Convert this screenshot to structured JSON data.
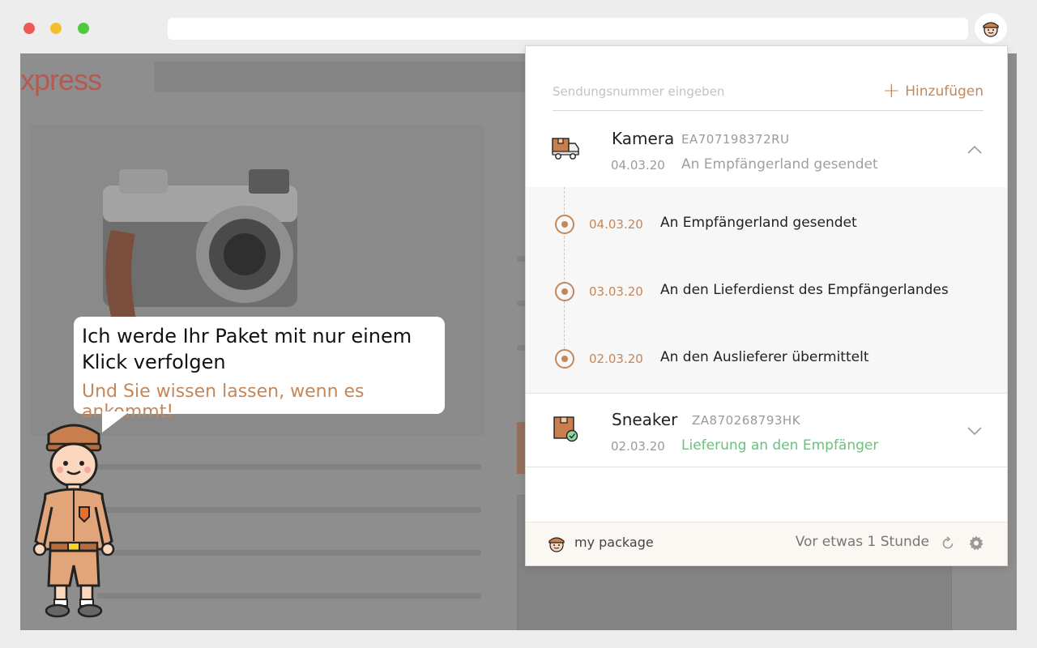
{
  "page": {
    "logo_text": "xpress"
  },
  "popup": {
    "search": {
      "placeholder": "Sendungsnummer eingeben",
      "add_label": "Hinzufügen"
    },
    "packages": [
      {
        "name": "Kamera",
        "code": "EA707198372RU",
        "date": "04.03.20",
        "status": "An Empfängerland gesendet",
        "icon": "delivery-truck-icon",
        "expanded": true,
        "events": [
          {
            "date": "04.03.20",
            "text": "An Empfängerland gesendet"
          },
          {
            "date": "03.03.20",
            "text": "An den Lieferdienst des Empfängerlandes"
          },
          {
            "date": "02.03.20",
            "text": "An den Auslieferer übermittelt"
          }
        ]
      },
      {
        "name": "Sneaker",
        "code": "ZA870268793HK",
        "date": "02.03.20",
        "status": "Lieferung an den Empfänger",
        "icon": "delivered-box-icon",
        "status_color": "#6cbf7f",
        "expanded": false
      }
    ],
    "footer": {
      "brand": "my package",
      "last_updated": "Vor etwas 1 Stunde"
    }
  },
  "bubble": {
    "title": "Ich werde Ihr Paket mit nur einem Klick verfolgen",
    "subtitle": "Und Sie wissen lassen, wenn es ankommt!"
  },
  "colors": {
    "accent": "#c4875a",
    "success": "#6cbf7f"
  }
}
